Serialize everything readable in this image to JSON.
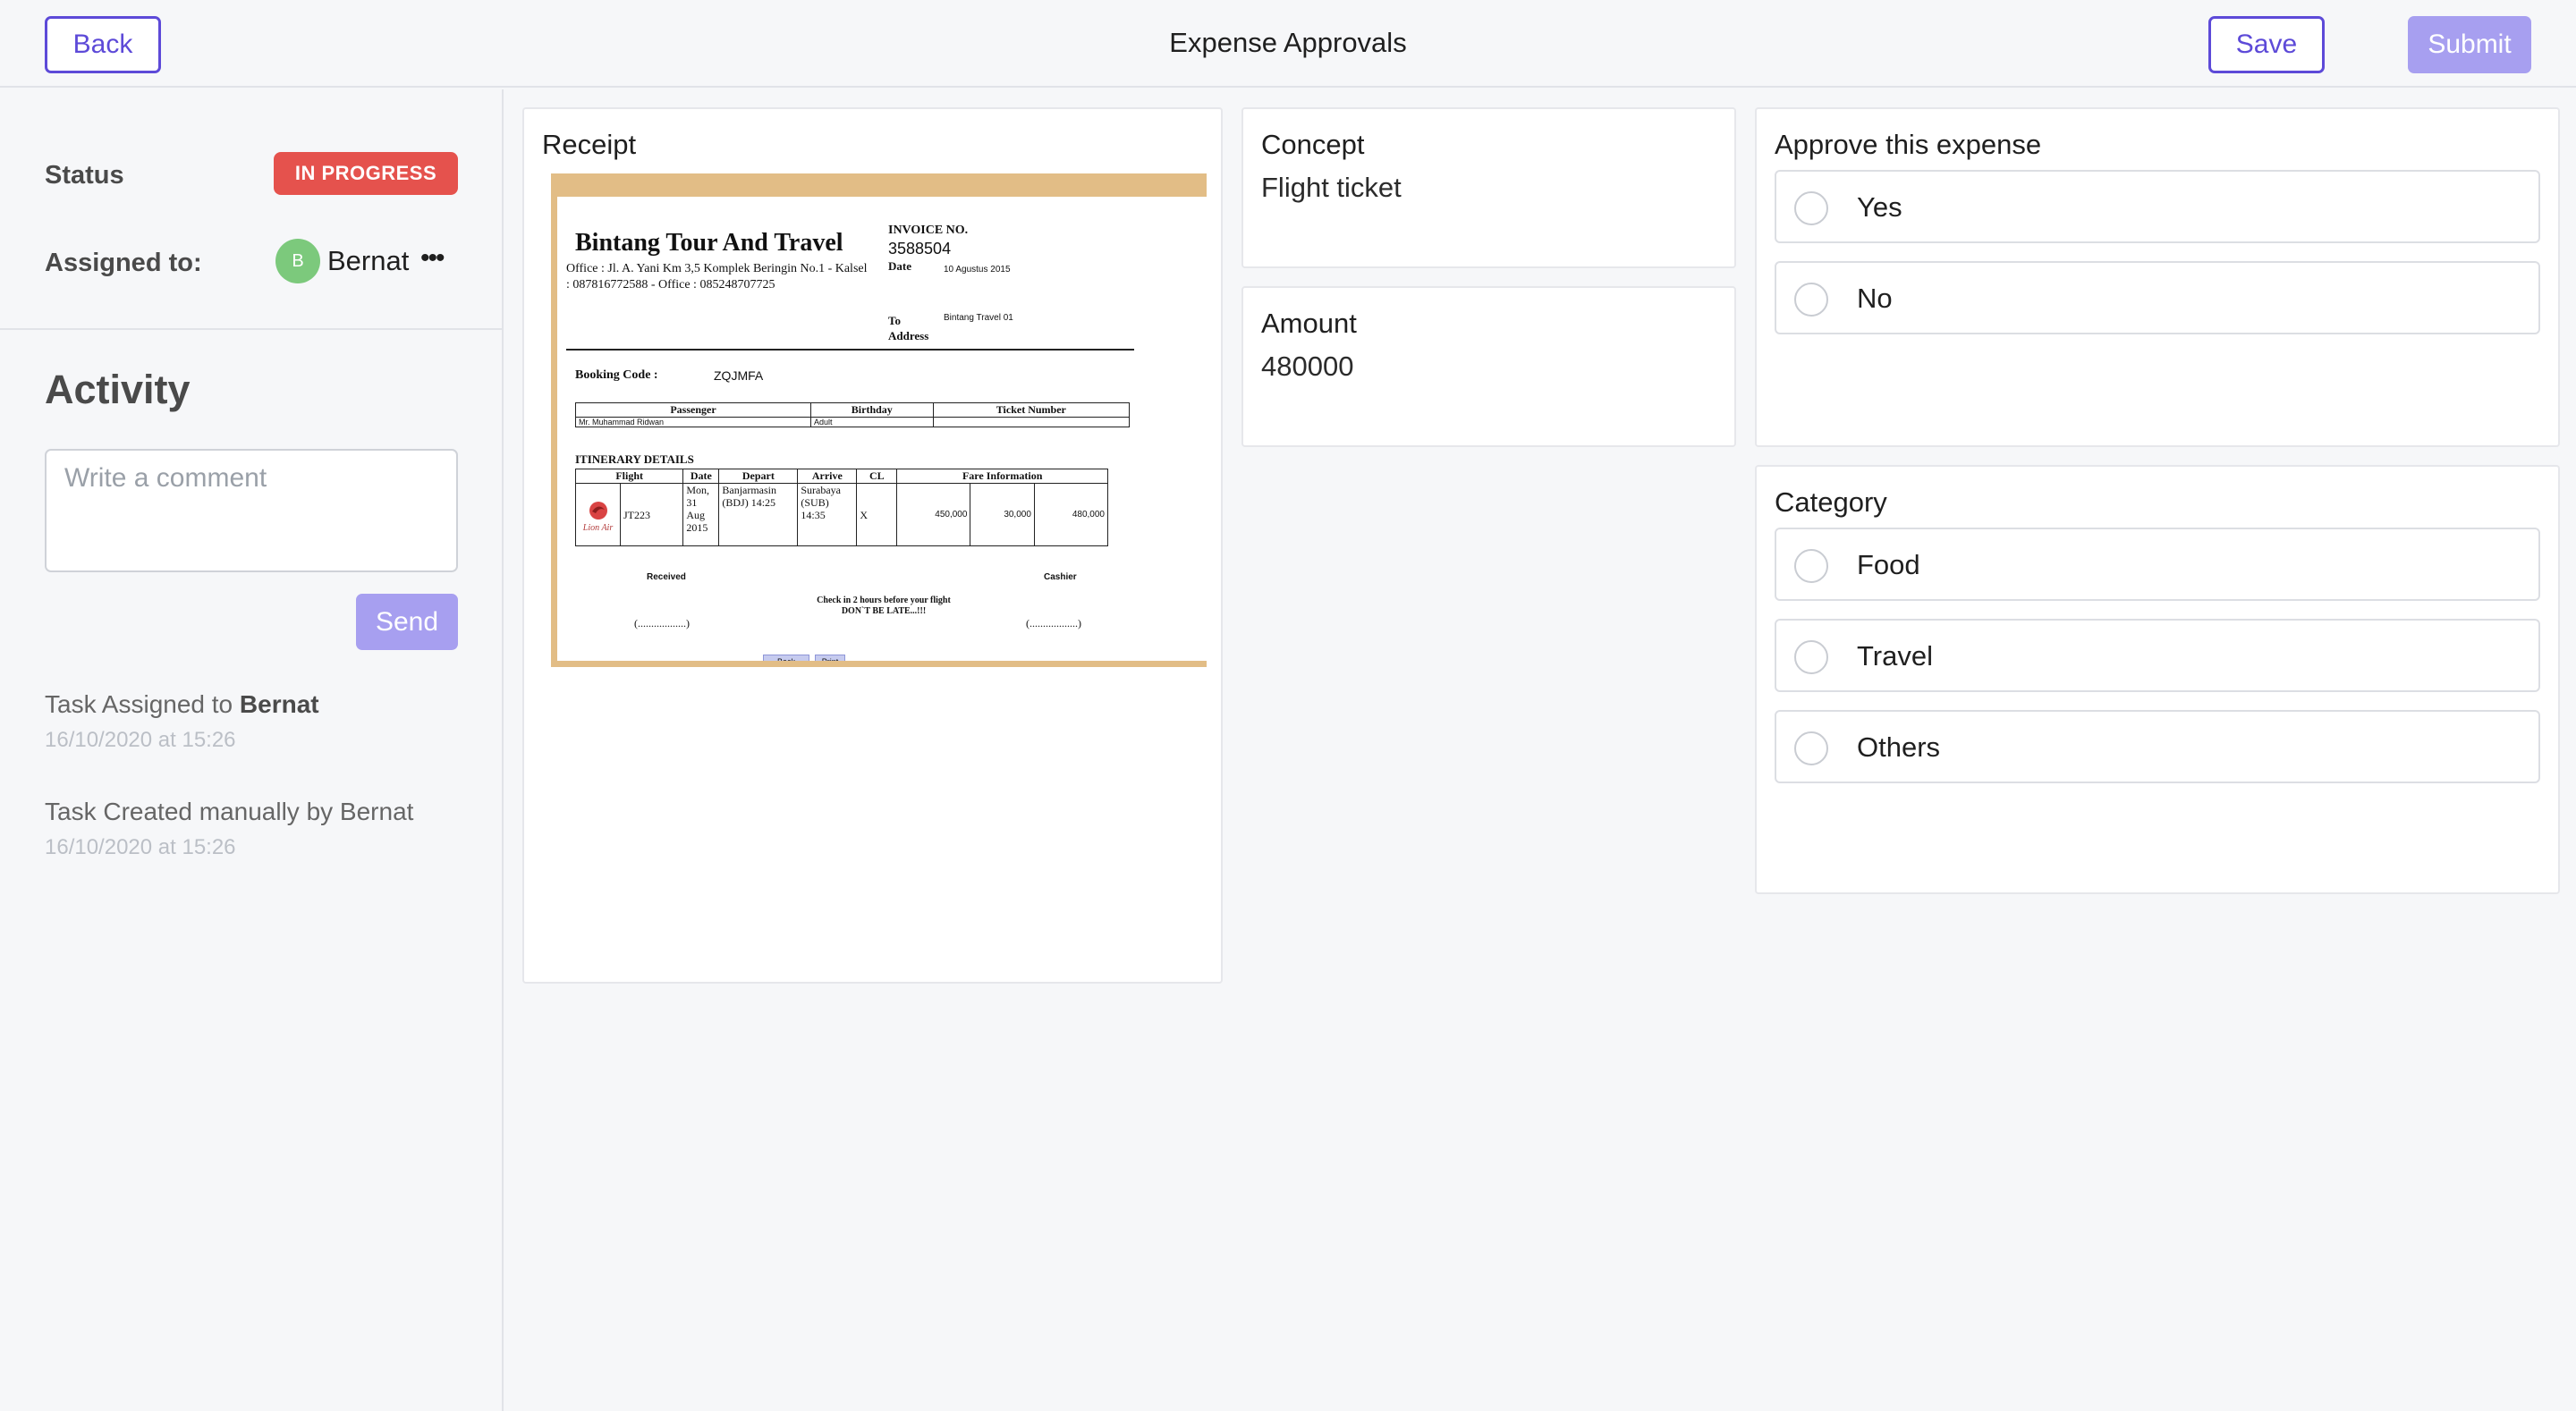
{
  "header": {
    "title": "Expense Approvals",
    "back_label": "Back",
    "save_label": "Save",
    "submit_label": "Submit"
  },
  "sidebar": {
    "status_label": "Status",
    "status_value": "IN PROGRESS",
    "assigned_label": "Assigned to:",
    "assignee_initial": "B",
    "assignee_name": "Bernat",
    "activity_title": "Activity",
    "comment_placeholder": "Write a comment",
    "send_label": "Send",
    "activity": [
      {
        "text": "Task Assigned to ",
        "bold": "Bernat",
        "time": "16/10/2020 at 15:26"
      },
      {
        "text": "Task Created manually by Bernat",
        "bold": "",
        "time": "16/10/2020 at 15:26"
      }
    ]
  },
  "receipt": {
    "title": "Receipt",
    "doc": {
      "header": "INVOICE",
      "company": "Bintang Tour And Travel",
      "office": "Office : Jl. A. Yani Km 3,5 Komplek Beringin No.1 - Kalsel",
      "phones": ": 087816772588 - Office : 085248707725",
      "invoice_label": "INVOICE NO.",
      "invoice_no": "3588504",
      "date_label": "Date",
      "date_value": "10 Agustus 2015",
      "to_label": "To",
      "address_label": "Address",
      "to_value": "Bintang Travel 01",
      "booking_label": "Booking Code :",
      "booking_value": "ZQJMFA",
      "pax_headers": [
        "Passenger",
        "Birthday",
        "Ticket Number"
      ],
      "pax_row": [
        "Mr. Muhammad Ridwan",
        "Adult",
        ""
      ],
      "itinerary_label": "ITINERARY DETAILS",
      "itin_headers": [
        "Flight",
        "Date",
        "Depart",
        "Arrive",
        "CL",
        "Fare Information"
      ],
      "airline": "Lion Air",
      "flight": "JT223",
      "date": "Mon, 31 Aug 2015",
      "depart": "Banjarmasin (BDJ) 14:25",
      "arrive": "Surabaya (SUB) 14:35",
      "cl": "X",
      "fare": "450,000",
      "tax": "30,000",
      "total": "480,000",
      "received": "Received",
      "cashier": "Cashier",
      "checkin": "Check in 2 hours before your flight",
      "late": "DON`T BE LATE...!!!",
      "signature": "(..................)",
      "back_btn": "Back",
      "print_btn": "Print"
    }
  },
  "concept": {
    "title": "Concept",
    "value": "Flight ticket"
  },
  "amount": {
    "title": "Amount",
    "value": "480000"
  },
  "approve": {
    "title": "Approve this expense",
    "options": [
      "Yes",
      "No"
    ]
  },
  "category": {
    "title": "Category",
    "options": [
      "Food",
      "Travel",
      "Others"
    ]
  },
  "colors": {
    "accent": "#5d4ad8",
    "accent_light": "#a79ff0",
    "status_red": "#e5524d",
    "avatar_green": "#7cc97c"
  }
}
